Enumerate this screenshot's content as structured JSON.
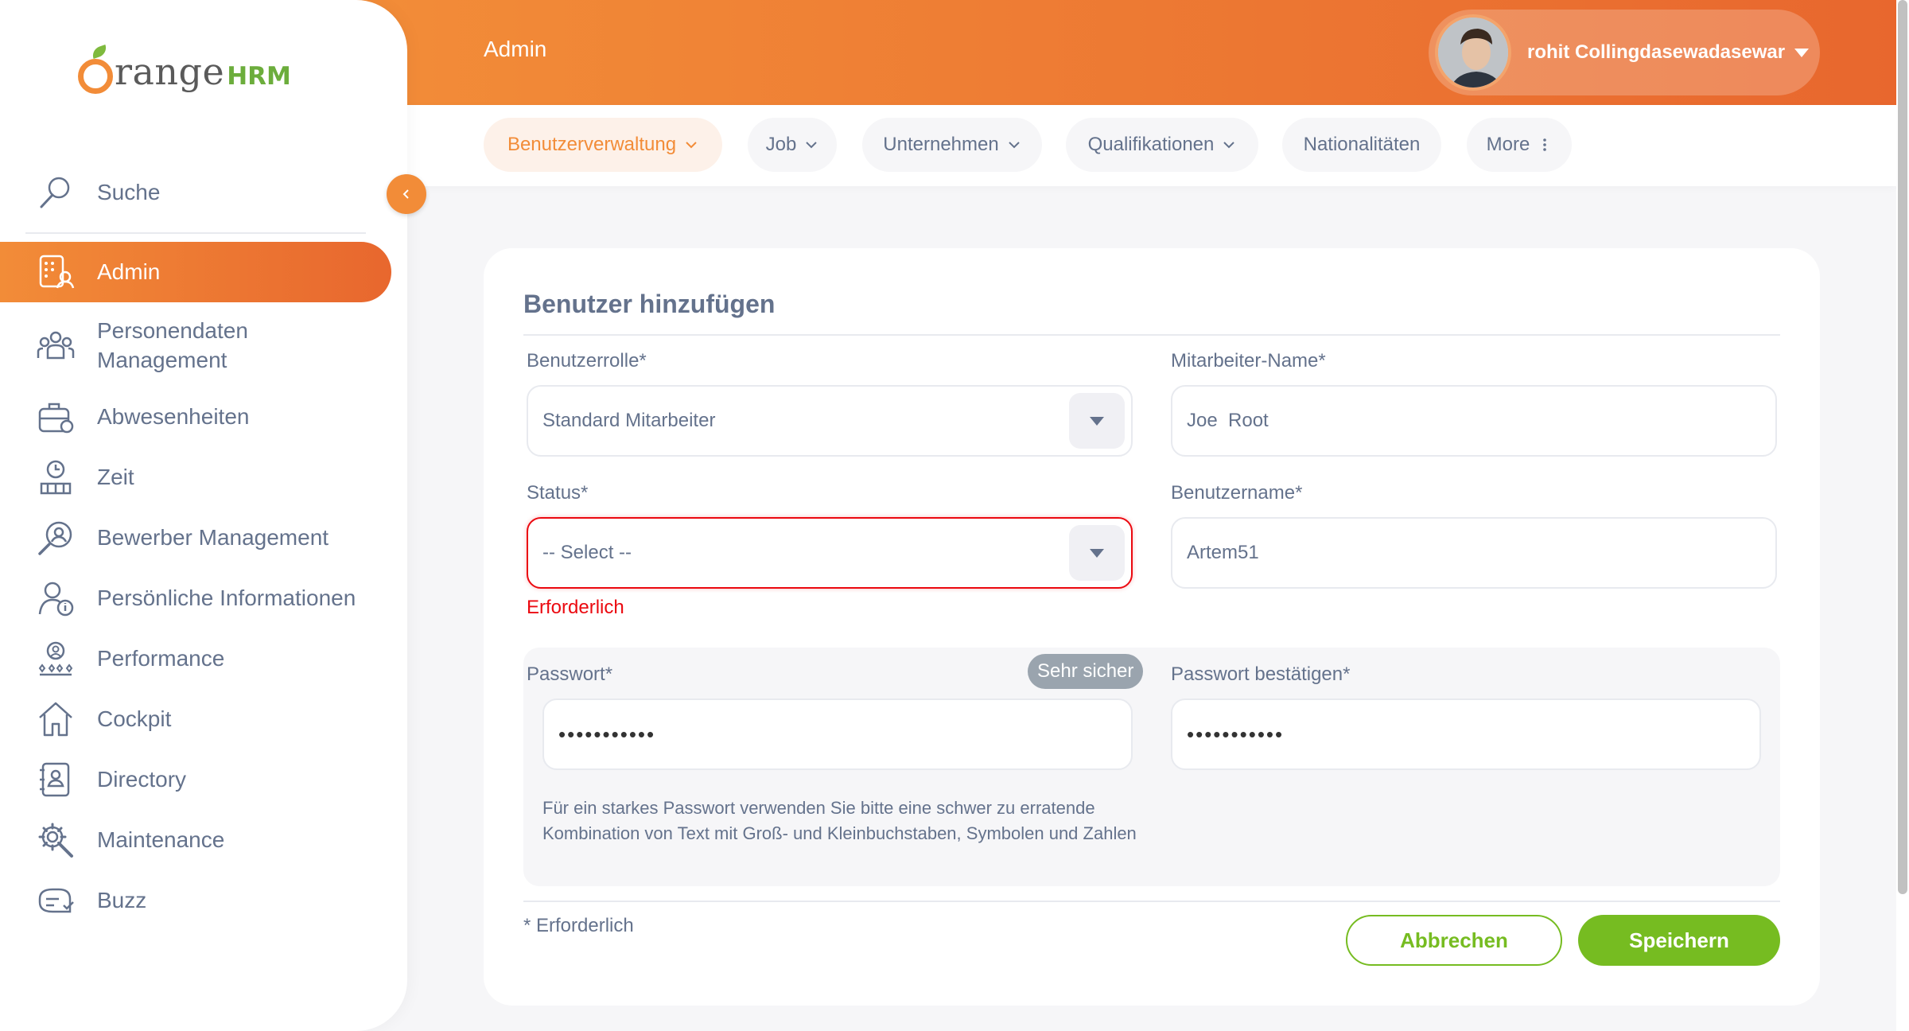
{
  "header": {
    "page_title": "Admin",
    "user_name": "rohit Collingdasewadasewar"
  },
  "logo": {
    "text_o": "O",
    "text_range": "range",
    "text_hrm": "HRM"
  },
  "sidebar": {
    "search_label": "Suche",
    "items": [
      {
        "label": "Admin",
        "icon": "admin-icon"
      },
      {
        "label": "Personendaten Management",
        "icon": "people-icon"
      },
      {
        "label": "Abwesenheiten",
        "icon": "leave-icon"
      },
      {
        "label": "Zeit",
        "icon": "time-icon"
      },
      {
        "label": "Bewerber Management",
        "icon": "recruitment-icon"
      },
      {
        "label": "Persönliche Informationen",
        "icon": "my-info-icon"
      },
      {
        "label": "Performance",
        "icon": "performance-icon"
      },
      {
        "label": "Cockpit",
        "icon": "home-icon"
      },
      {
        "label": "Directory",
        "icon": "directory-icon"
      },
      {
        "label": "Maintenance",
        "icon": "gear-icon"
      },
      {
        "label": "Buzz",
        "icon": "chat-icon"
      }
    ]
  },
  "subnav": {
    "tabs": [
      {
        "label": "Benutzerverwaltung"
      },
      {
        "label": "Job"
      },
      {
        "label": "Unternehmen"
      },
      {
        "label": "Qualifikationen"
      },
      {
        "label": "Nationalitäten"
      },
      {
        "label": "More"
      }
    ]
  },
  "form": {
    "title": "Benutzer hinzufügen",
    "user_role_label": "Benutzerrolle*",
    "user_role_value": "Standard Mitarbeiter",
    "employee_name_label": "Mitarbeiter-Name*",
    "employee_name_value": "Joe  Root",
    "status_label": "Status*",
    "status_value": "-- Select --",
    "status_error": "Erforderlich",
    "username_label": "Benutzername*",
    "username_value": "Artem51",
    "password_label": "Passwort*",
    "password_strength": "Sehr sicher",
    "password_value": "•••••••••••",
    "confirm_password_label": "Passwort bestätigen*",
    "confirm_password_value": "•••••••••••",
    "password_hint": "Für ein starkes Passwort verwenden Sie bitte eine schwer zu erratende Kombination von Text mit Groß- und Kleinbuchstaben, Symbolen und Zahlen",
    "required_note": "* Erforderlich",
    "cancel_label": "Abbrechen",
    "save_label": "Speichern"
  },
  "colors": {
    "accent": "#f28c38",
    "accent_dark": "#e8672e",
    "success": "#76bc21",
    "error": "#eb0910",
    "text": "#64728c"
  }
}
